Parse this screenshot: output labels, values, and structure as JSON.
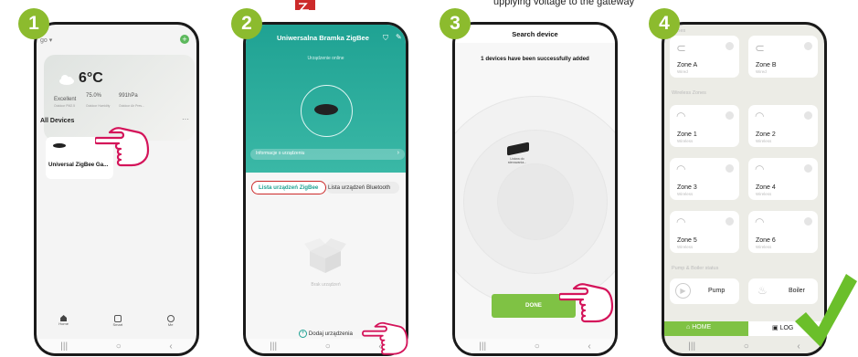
{
  "colors": {
    "badge": "#8cbb2e",
    "teal": "#1fa293",
    "green": "#7fc244",
    "check": "#6bbf2a",
    "red": "#cc2a2a"
  },
  "steps": [
    {
      "number": "1"
    },
    {
      "number": "2"
    },
    {
      "number": "3"
    },
    {
      "number": "4"
    }
  ],
  "top_caption": "upplying voltage to the gateway",
  "screen1": {
    "home_label": "go",
    "temperature": "6°C",
    "pm": "Excellent",
    "pm_sub": "Outdoor PM2.5",
    "humidity": "75.0%",
    "humidity_sub": "Outdoor Humidity",
    "pressure": "991hPa",
    "pressure_sub": "Outdoor Air Pres...",
    "all_devices": "All Devices",
    "more": "···",
    "device_name": "Universal ZigBee Ga...",
    "tabs": [
      "Home",
      "Smart",
      "Me"
    ]
  },
  "screen2": {
    "title": "Uniwersalna Bramka ZigBee",
    "status": "Urządzenie online",
    "info_bar": "Informacje o urządzeniu",
    "tab_active": "Lista urządzeń ZigBee",
    "tab_other": "Lista urządzeń Bluetooth",
    "empty": "Brak urządzeń",
    "add_button": "Dodaj urządzenia"
  },
  "screen3": {
    "title": "Search device",
    "message": "1 devices have been successfully added",
    "device_label": "Listwa do sterowania...",
    "done": "DONE"
  },
  "screen4": {
    "top_faint": "Zones",
    "wireless_header": "Wireless Zones",
    "pump_header": "Pump & Boiler status",
    "zones": [
      {
        "name": "Zone A",
        "sub": "Wired"
      },
      {
        "name": "Zone B",
        "sub": "Wired"
      },
      {
        "name": "Zone 1",
        "sub": "Wireless"
      },
      {
        "name": "Zone 2",
        "sub": "Wireless"
      },
      {
        "name": "Zone 3",
        "sub": "Wireless"
      },
      {
        "name": "Zone 4",
        "sub": "Wireless"
      },
      {
        "name": "Zone 5",
        "sub": "Wireless"
      },
      {
        "name": "Zone 6",
        "sub": "Wireless"
      }
    ],
    "pump": "Pump",
    "boiler": "Boiler",
    "home_tab": "HOME",
    "log_tab": "LOG"
  }
}
